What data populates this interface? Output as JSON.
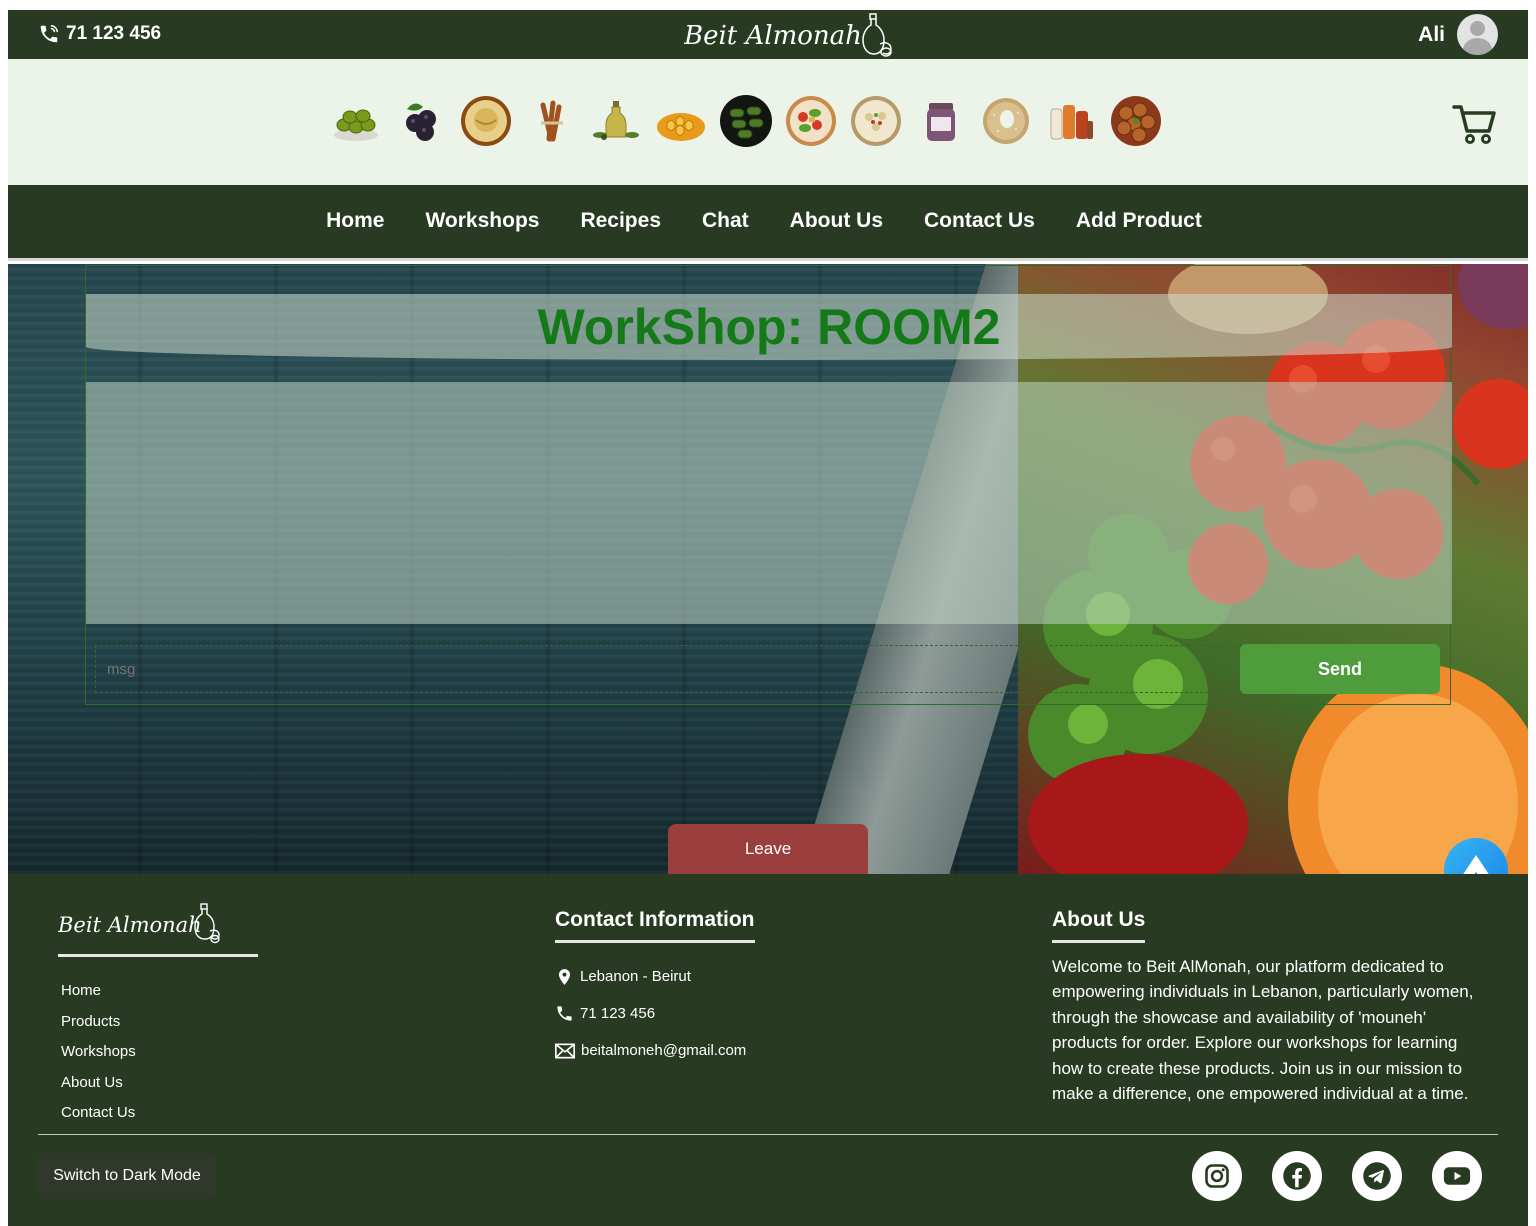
{
  "topbar": {
    "phone": "71 123 456",
    "brand": "Beit Almonah",
    "user_name": "Ali"
  },
  "products": [
    {
      "icon": "olives-icon"
    },
    {
      "icon": "blackberries-icon"
    },
    {
      "icon": "hummus-icon"
    },
    {
      "icon": "cinnamon-icon"
    },
    {
      "icon": "olive-oil-icon"
    },
    {
      "icon": "honeycomb-icon"
    },
    {
      "icon": "stuffed-grape-leaves-icon"
    },
    {
      "icon": "fattoush-salad-icon"
    },
    {
      "icon": "labneh-plate-icon"
    },
    {
      "icon": "jam-jar-icon"
    },
    {
      "icon": "kaak-bread-icon"
    },
    {
      "icon": "spices-jars-icon"
    },
    {
      "icon": "falafel-icon"
    }
  ],
  "nav": {
    "items": [
      "Home",
      "Workshops",
      "Recipes",
      "Chat",
      "About Us",
      "Contact Us",
      "Add Product"
    ]
  },
  "room": {
    "title": "WorkShop: ROOM2",
    "msg_placeholder": "msg",
    "send_label": "Send",
    "leave_label": "Leave"
  },
  "footer": {
    "brand": "Beit Almonah",
    "links": [
      "Home",
      "Products",
      "Workshops",
      "About Us",
      "Contact Us"
    ],
    "contact_title": "Contact Information",
    "location": "Lebanon - Beirut",
    "phone": "71 123 456",
    "email": "beitalmoneh@gmail.com",
    "about_title": "About Us",
    "about_text": "Welcome to Beit AlMonah, our platform dedicated to empowering individuals in Lebanon, particularly women, through the showcase and availability of 'mouneh' products for order. Explore our workshops for learning how to create these products. Join us in our mission to make a difference, one empowered individual at a time.",
    "dark_mode_label": "Switch to Dark Mode",
    "socials": [
      "instagram-icon",
      "facebook-icon",
      "telegram-icon",
      "youtube-icon"
    ]
  },
  "colors": {
    "dark_green": "#283a22",
    "strip_bg": "#ecf4e9",
    "title_green": "#137a17",
    "send_green": "#4f9c3d",
    "leave_red": "#9a3e3e"
  }
}
